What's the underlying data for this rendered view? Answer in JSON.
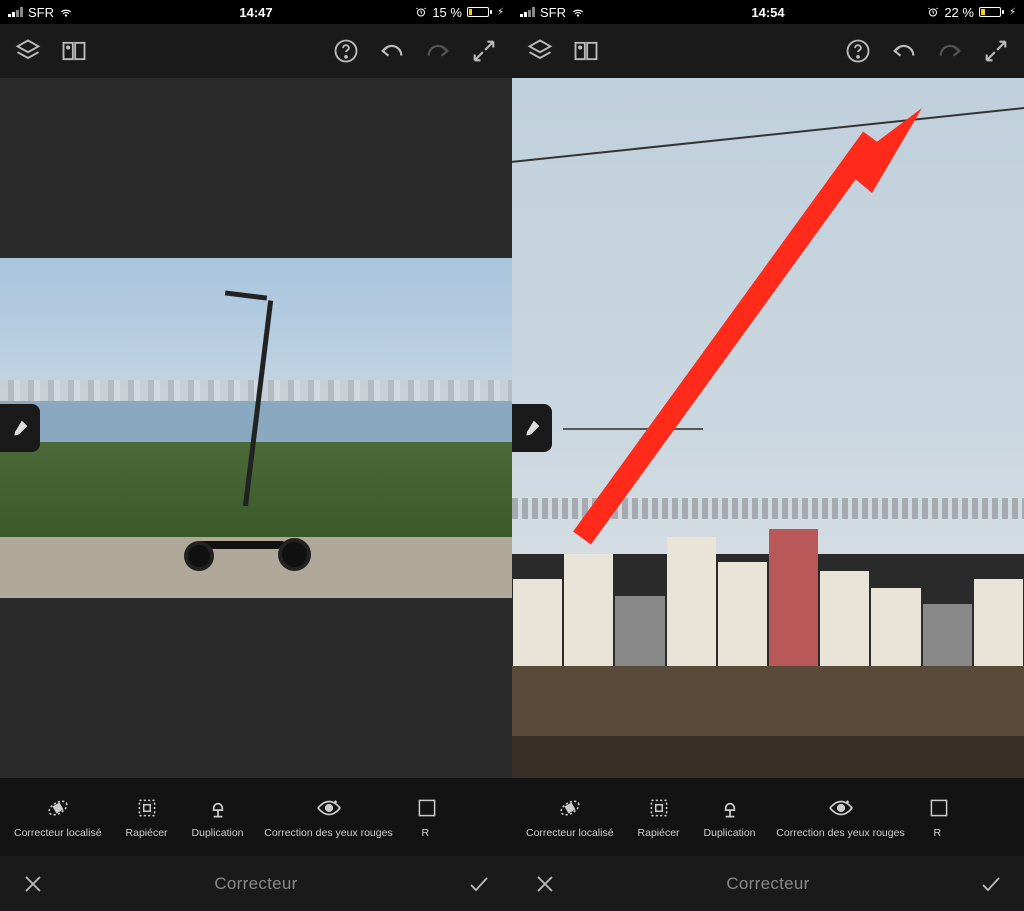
{
  "left": {
    "status": {
      "carrier": "SFR",
      "time": "14:47",
      "battery_pct": "15 %",
      "battery_fill": 15
    },
    "tools": [
      {
        "label": "Correcteur localisé"
      },
      {
        "label": "Rapiécer"
      },
      {
        "label": "Duplication"
      },
      {
        "label": "Correction des yeux rouges"
      },
      {
        "label_cut": "R"
      }
    ],
    "mode_title": "Correcteur"
  },
  "right": {
    "status": {
      "carrier": "SFR",
      "time": "14:54",
      "battery_pct": "22 %",
      "battery_fill": 22
    },
    "tools": [
      {
        "label": "Correcteur localisé"
      },
      {
        "label": "Rapiécer"
      },
      {
        "label": "Duplication"
      },
      {
        "label": "Correction des yeux rouges"
      },
      {
        "label_cut": "R"
      }
    ],
    "mode_title": "Correcteur"
  },
  "annotation": {
    "color": "#ff2a1a"
  }
}
